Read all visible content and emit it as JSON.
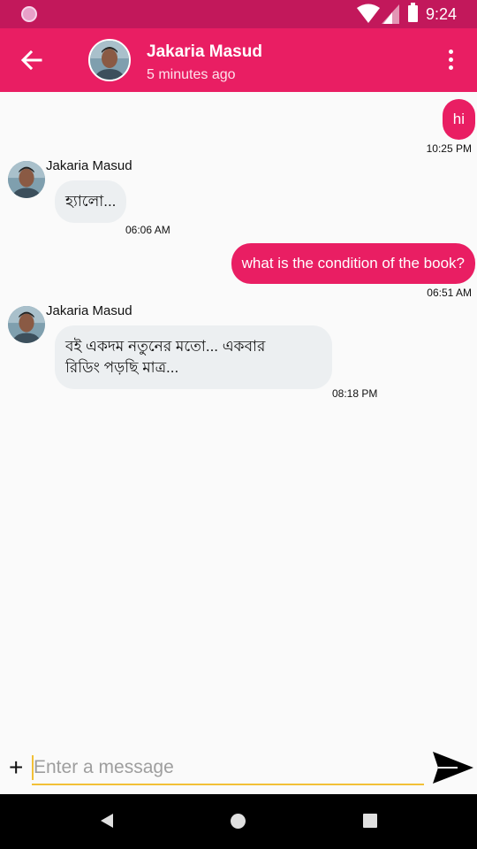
{
  "status_bar": {
    "time": "9:24"
  },
  "header": {
    "contact_name": "Jakaria Masud",
    "contact_status": "5 minutes ago"
  },
  "messages": [
    {
      "direction": "outgoing",
      "text": "hi",
      "time": "10:25 PM"
    },
    {
      "direction": "incoming",
      "sender": "Jakaria Masud",
      "text": "হ্যালো...",
      "time": "06:06 AM"
    },
    {
      "direction": "outgoing",
      "text": "what is the condition of the book?",
      "time": "06:51 AM"
    },
    {
      "direction": "incoming",
      "sender": "Jakaria Masud",
      "text_line1": "বই একদম নতুনের মতো... একবার",
      "text_line2": "রিডিং পড়ছি মাত্র...",
      "time": "08:18 PM"
    }
  ],
  "composer": {
    "add_label": "+",
    "placeholder": "Enter a message"
  },
  "colors": {
    "status_bar": "#c2185b",
    "app_bar": "#e91e63",
    "outgoing_bubble": "#e91e63",
    "incoming_bubble": "#eceff1",
    "input_underline": "#f2c037"
  }
}
